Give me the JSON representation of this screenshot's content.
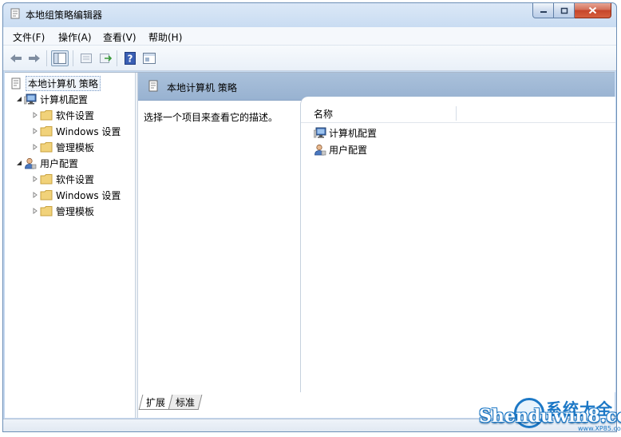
{
  "window": {
    "title": "本地组策略编辑器"
  },
  "menu": [
    {
      "label": "文件(F)"
    },
    {
      "label": "操作(A)"
    },
    {
      "label": "查看(V)"
    },
    {
      "label": "帮助(H)"
    }
  ],
  "tree": {
    "root": "本地计算机 策略",
    "computer_config": "计算机配置",
    "user_config": "用户配置",
    "software_settings": "软件设置",
    "windows_settings": "Windows 设置",
    "admin_templates": "管理模板"
  },
  "right_pane": {
    "header_title": "本地计算机 策略",
    "description": "选择一个项目来查看它的描述。",
    "column_name": "名称",
    "items": [
      {
        "label": "计算机配置"
      },
      {
        "label": "用户配置"
      }
    ]
  },
  "tabs": [
    {
      "label": "扩展"
    },
    {
      "label": "标准"
    }
  ],
  "watermark": {
    "title": "系统大全",
    "main": "Shenduwin8.com",
    "sub": "www.XP85.com"
  },
  "colors": {
    "header_bg": "#98b2d1",
    "folder": "#f1d27a",
    "close_button": "#c6462b"
  }
}
